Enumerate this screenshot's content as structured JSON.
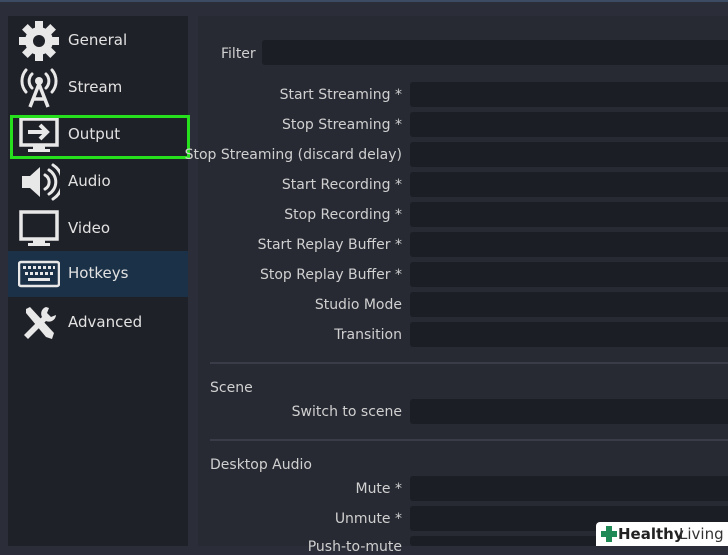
{
  "sidebar": {
    "items": [
      {
        "label": "General",
        "icon": "gear-icon"
      },
      {
        "label": "Stream",
        "icon": "broadcast-tower-icon"
      },
      {
        "label": "Output",
        "icon": "output-monitor-icon"
      },
      {
        "label": "Audio",
        "icon": "speaker-icon"
      },
      {
        "label": "Video",
        "icon": "monitor-icon"
      },
      {
        "label": "Hotkeys",
        "icon": "keyboard-icon"
      },
      {
        "label": "Advanced",
        "icon": "tools-icon"
      }
    ],
    "active": "Hotkeys",
    "highlighted": "Output",
    "highlight_color": "#26e01d"
  },
  "filter": {
    "label": "Filter",
    "value": ""
  },
  "hotkeys": {
    "rows": [
      {
        "label": "Start Streaming *",
        "value": ""
      },
      {
        "label": "Stop Streaming *",
        "value": ""
      },
      {
        "label": "Stop Streaming (discard delay)",
        "value": ""
      },
      {
        "label": "Start Recording *",
        "value": ""
      },
      {
        "label": "Stop Recording *",
        "value": ""
      },
      {
        "label": "Start Replay Buffer *",
        "value": ""
      },
      {
        "label": "Stop Replay Buffer *",
        "value": ""
      },
      {
        "label": "Studio Mode",
        "value": ""
      },
      {
        "label": "Transition",
        "value": ""
      }
    ]
  },
  "scene": {
    "title": "Scene",
    "rows": [
      {
        "label": "Switch to scene",
        "value": ""
      }
    ]
  },
  "desktop_audio": {
    "title": "Desktop Audio",
    "rows": [
      {
        "label": "Mute *",
        "value": ""
      },
      {
        "label": "Unmute *",
        "value": ""
      },
      {
        "label": "Push-to-mute",
        "value": ""
      }
    ]
  },
  "watermark": {
    "brand": "Healthy",
    "word": "Living"
  }
}
